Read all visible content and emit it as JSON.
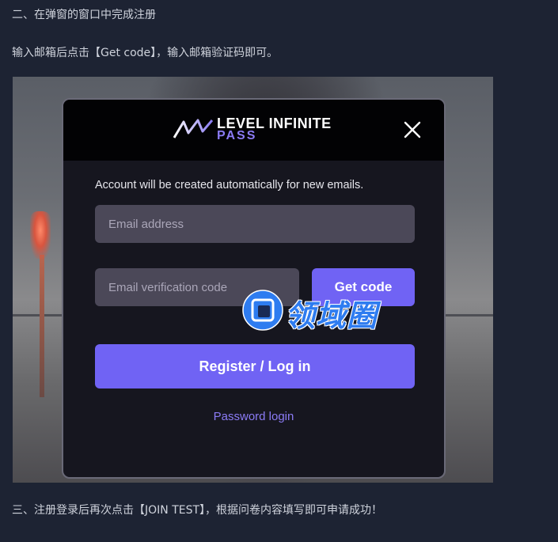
{
  "article": {
    "step2": "二、在弹窗的窗口中完成注册",
    "instruction": "输入邮箱后点击【Get code】，输入邮箱验证码即可。",
    "step3": "三、注册登录后再次点击【JOIN TEST】，根据问卷内容填写即可申请成功！"
  },
  "modal": {
    "logo_line1": "LEVEL INFINITE",
    "logo_line2": "PASS",
    "close_icon": "close-icon",
    "notice": "Account will be created automatically for new emails.",
    "email_placeholder": "Email address",
    "email_value": "",
    "code_placeholder": "Email verification code",
    "code_value": "",
    "get_code_label": "Get code",
    "register_label": "Register / Log in",
    "password_login_label": "Password login"
  },
  "watermark": {
    "text": "领域圈",
    "icon": "watermark-logo-icon"
  },
  "colors": {
    "page_bg": "#1d2333",
    "modal_bg": "#16161f",
    "accent": "#7063f4",
    "link": "#8b7bf5",
    "input_bg": "#4b4858",
    "watermark": "#2e7cf0"
  }
}
